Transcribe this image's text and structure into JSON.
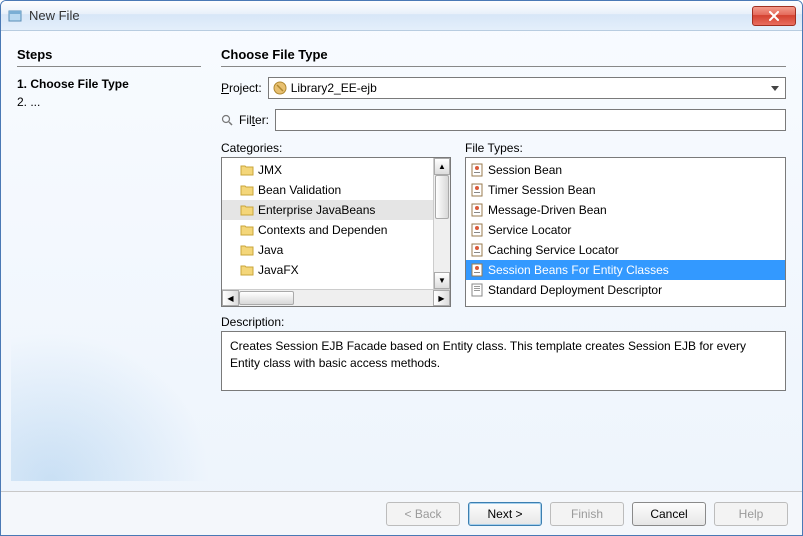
{
  "window": {
    "title": "New File"
  },
  "steps": {
    "heading": "Steps",
    "items": [
      {
        "num": "1.",
        "label": "Choose File Type",
        "bold": true
      },
      {
        "num": "2.",
        "label": "...",
        "bold": false
      }
    ]
  },
  "main": {
    "heading": "Choose File Type",
    "project_label": "Project:",
    "project_value": "Library2_EE-ejb",
    "filter_label": "Filter:",
    "filter_value": "",
    "categories_label": "Categories:",
    "filetypes_label": "File Types:",
    "description_label": "Description:",
    "description_text": "Creates Session EJB Facade based on Entity class. This template creates Session EJB for every Entity class with basic access methods."
  },
  "categories": [
    {
      "label": "JMX",
      "selected": false
    },
    {
      "label": "Bean Validation",
      "selected": false
    },
    {
      "label": "Enterprise JavaBeans",
      "selected": true
    },
    {
      "label": "Contexts and Dependen",
      "selected": false
    },
    {
      "label": "Java",
      "selected": false
    },
    {
      "label": "JavaFX",
      "selected": false
    }
  ],
  "filetypes": [
    {
      "label": "Session Bean",
      "selected": false
    },
    {
      "label": "Timer Session Bean",
      "selected": false
    },
    {
      "label": "Message-Driven Bean",
      "selected": false
    },
    {
      "label": "Service Locator",
      "selected": false
    },
    {
      "label": "Caching Service Locator",
      "selected": false
    },
    {
      "label": "Session Beans For Entity Classes",
      "selected": true
    },
    {
      "label": "Standard Deployment Descriptor",
      "selected": false
    }
  ],
  "buttons": {
    "back": "< Back",
    "next": "Next >",
    "finish": "Finish",
    "cancel": "Cancel",
    "help": "Help"
  }
}
